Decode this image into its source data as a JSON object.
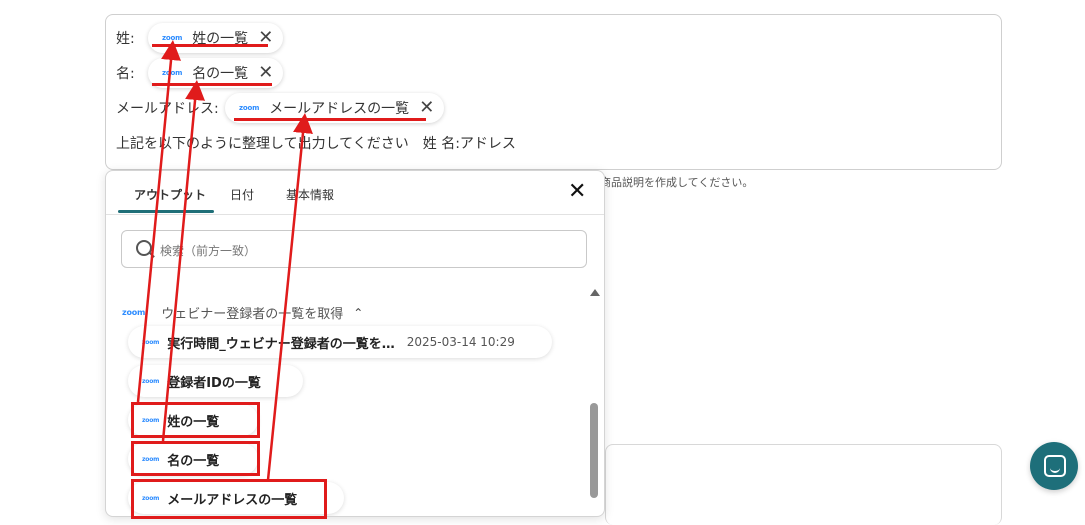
{
  "editor": {
    "row1_label": "姓:",
    "row1_chip": "姓の一覧",
    "row2_label": "名:",
    "row2_chip": "名の一覧",
    "row3_label": "メールアドレス:",
    "row3_chip": "メールアドレスの一覧",
    "instruction": "上記を以下のように整理して出力してください　姓 名:アドレス",
    "chip_logo": "zoom"
  },
  "helper_text": "商品説明を作成してください。",
  "panel": {
    "tabs": [
      "アウトプット",
      "日付",
      "基本情報"
    ],
    "close_symbol": "✕",
    "search_placeholder": "検索（前方一致）",
    "group_title": "ウェビナー登録者の一覧を取得",
    "group_logo": "zoom",
    "items": [
      {
        "label": "実行時間_ウェビナー登録者の一覧を…",
        "date": "2025-03-14 10:29"
      },
      {
        "label": "登録者IDの一覧"
      },
      {
        "label": "姓の一覧"
      },
      {
        "label": "名の一覧"
      },
      {
        "label": "メールアドレスの一覧"
      }
    ]
  },
  "colors": {
    "accent": "#1f6f78",
    "annotation": "#e01b1b",
    "zoom_blue": "#2d8cff"
  },
  "icons": [
    "zoom-logo-icon",
    "close-icon",
    "search-icon",
    "chevron-up-icon",
    "chat-icon"
  ]
}
